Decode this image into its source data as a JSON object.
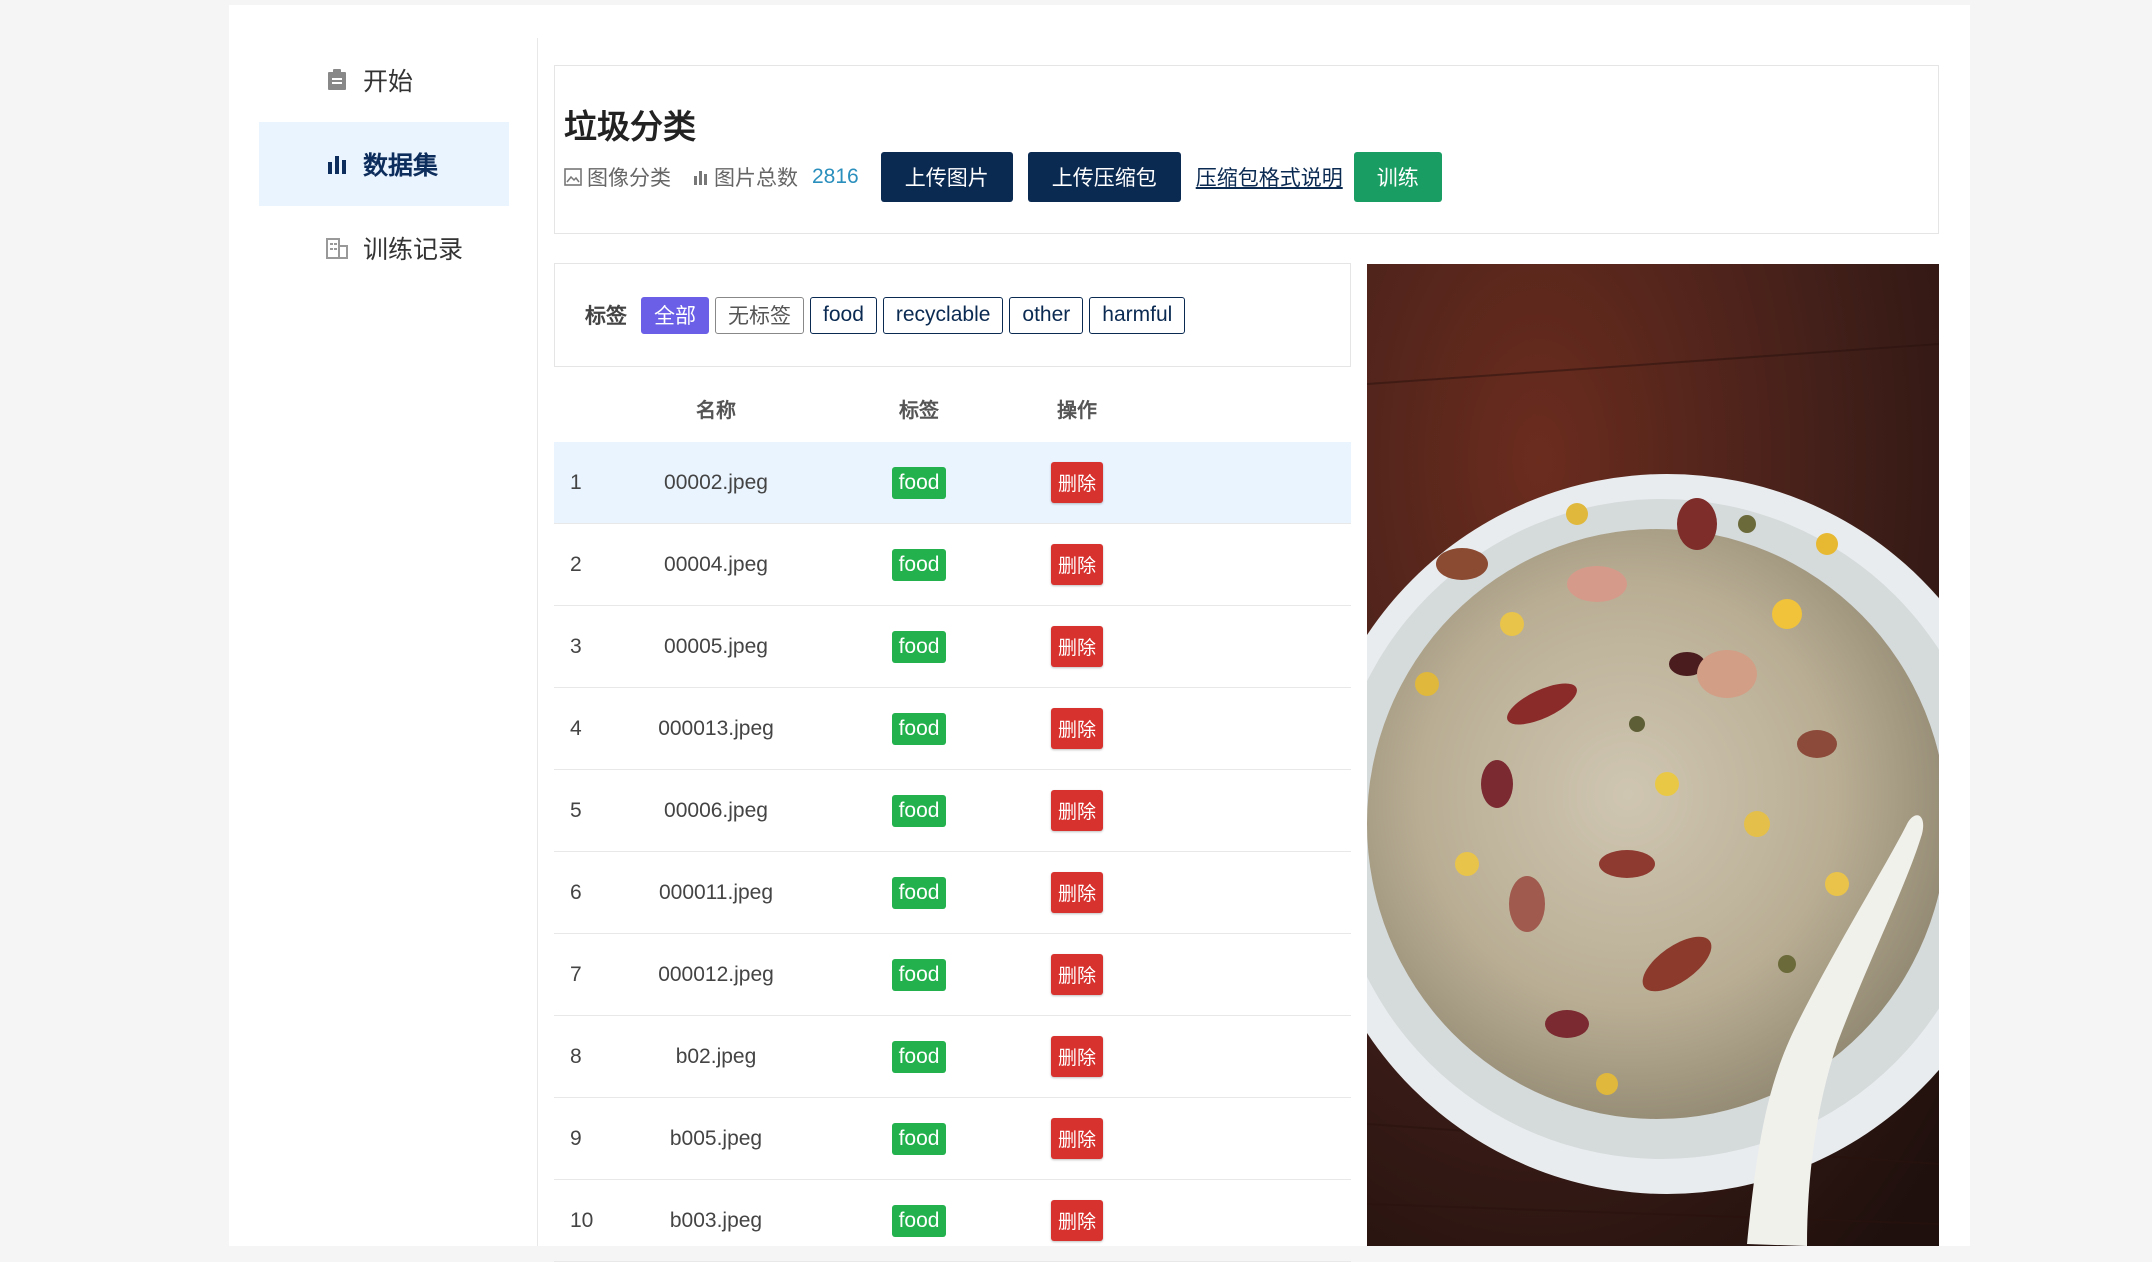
{
  "sidebar": {
    "items": [
      {
        "label": "开始",
        "icon": "clipboard-icon",
        "active": false
      },
      {
        "label": "数据集",
        "icon": "bar-chart-icon",
        "active": true
      },
      {
        "label": "训练记录",
        "icon": "building-icon",
        "active": false
      }
    ]
  },
  "header": {
    "title": "垃圾分类",
    "type_label": "图像分类",
    "total_label": "图片总数",
    "total_count": "2816",
    "upload_image_label": "上传图片",
    "upload_zip_label": "上传压缩包",
    "zip_format_link": "压缩包格式说明",
    "train_label": "训练"
  },
  "filter": {
    "label": "标签",
    "chips": [
      "全部",
      "无标签",
      "food",
      "recyclable",
      "other",
      "harmful"
    ],
    "active_index": 0
  },
  "table": {
    "headers": [
      "名称",
      "标签",
      "操作"
    ],
    "delete_label": "删除",
    "rows": [
      {
        "index": "1",
        "name": "00002.jpeg",
        "tag": "food"
      },
      {
        "index": "2",
        "name": "00004.jpeg",
        "tag": "food"
      },
      {
        "index": "3",
        "name": "00005.jpeg",
        "tag": "food"
      },
      {
        "index": "4",
        "name": "000013.jpeg",
        "tag": "food"
      },
      {
        "index": "5",
        "name": "00006.jpeg",
        "tag": "food"
      },
      {
        "index": "6",
        "name": "000011.jpeg",
        "tag": "food"
      },
      {
        "index": "7",
        "name": "000012.jpeg",
        "tag": "food"
      },
      {
        "index": "8",
        "name": "b02.jpeg",
        "tag": "food"
      },
      {
        "index": "9",
        "name": "b005.jpeg",
        "tag": "food"
      },
      {
        "index": "10",
        "name": "b003.jpeg",
        "tag": "food"
      }
    ]
  },
  "preview": {
    "icon": "porridge-bowl-photo"
  },
  "colors": {
    "primary_dark": "#0b2a52",
    "green": "#1a9d63",
    "tag_green": "#22b14c",
    "danger": "#d8322f",
    "chip_active": "#6a5fe6",
    "row_highlight": "#eaf4ff"
  }
}
